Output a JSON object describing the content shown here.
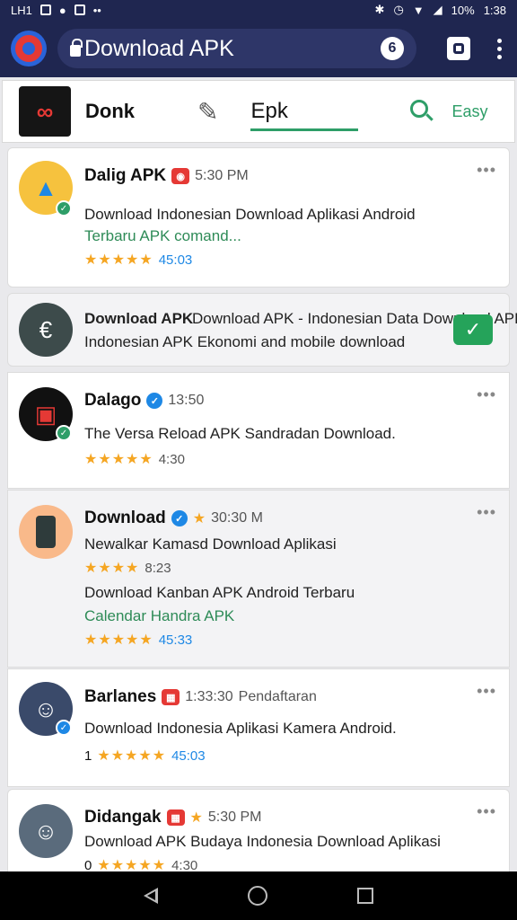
{
  "status": {
    "left_text": "LH1",
    "battery_text": "10%",
    "time": "1:38"
  },
  "browser": {
    "url": "Download APK",
    "url_icon": "6"
  },
  "appbar": {
    "app_name": "Donk",
    "tab_label": "Epk",
    "action_label": "Easy"
  },
  "items": [
    {
      "title": "Dalig APK",
      "meta": "5:30 PM",
      "desc1": "Download Indonesian Download Aplikasi Android",
      "desc2": "Terbaru APK comand...",
      "stars": "★★★★★",
      "count": "45:03"
    },
    {
      "title": "Download APK",
      "desc1": "Download APK - Indonesian Data Download APK",
      "desc2": "Indonesian APK Ekonomi and mobile download"
    },
    {
      "title": "Dalago",
      "meta": "13:50",
      "desc1": "The Versa Reload APK Sandradan Download.",
      "stars": "★★★★★",
      "count": "4:30"
    },
    {
      "title": "Download",
      "meta": "30:30 M",
      "desc1": "Newalkar Kamasd Download Aplikasi",
      "stars": "★★★★",
      "count": "8:23",
      "desc2": "Download Kanban APK Android Terbaru",
      "desc3": "Calendar Handra APK",
      "stars2": "★★★★★",
      "count2": "45:33"
    },
    {
      "title": "Barlanes",
      "meta": "1:33:30",
      "meta2": "Pendaftaran",
      "desc1": "Download Indonesia Aplikasi Kamera Android.",
      "lead": "1",
      "stars": "★★★★★",
      "count": "45:03"
    },
    {
      "title": "Didangak",
      "meta": "5:30 PM",
      "desc1": "Download APK Budaya Indonesia Download Aplikasi",
      "lead": "0",
      "stars": "★★★★★",
      "count": "4:30"
    }
  ]
}
